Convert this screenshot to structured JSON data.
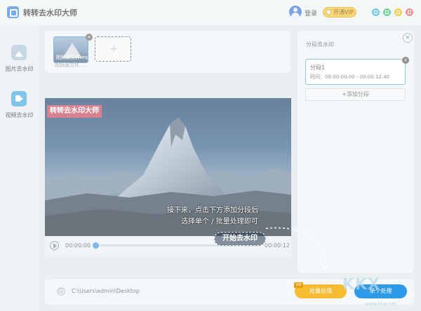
{
  "app": {
    "title": "转转去水印大师"
  },
  "header": {
    "login": "登录",
    "vip_button": "开通VIP"
  },
  "sidebar": {
    "items": [
      {
        "label": "图片去水印"
      },
      {
        "label": "视频去水印"
      }
    ]
  },
  "thumbnails": {
    "items": [
      {
        "name": "视频源文件.mp",
        "caption": "视频源文件...."
      }
    ],
    "add_symbol": "+"
  },
  "video": {
    "watermark_text": "转转去水印大师",
    "time_current": "00:00:00",
    "time_total": "00:00:12"
  },
  "segments": {
    "title": "分段去水印",
    "items": [
      {
        "name": "分段1",
        "time": "时间：00:00:00.00 - 00:00:12.40"
      }
    ],
    "add_label": "+添加分段"
  },
  "tutorial": {
    "line1": "接下来，点击下方添加分段后",
    "line2": "选择单个 / 批量处理即可",
    "start_label": "开始去水印"
  },
  "footer": {
    "output_path": "C:\\Users\\admin\\Desktop",
    "batch_label": "批量处理",
    "vip_tag": "VIP",
    "single_label": "单个处理"
  },
  "site_watermark": {
    "text": "KKX",
    "sub": "www.kkx.net"
  },
  "icons": {
    "close": "×"
  },
  "colors": {
    "accent": "#2f9be8",
    "vip": "#f6c12c",
    "watermark": "#e23e50"
  }
}
